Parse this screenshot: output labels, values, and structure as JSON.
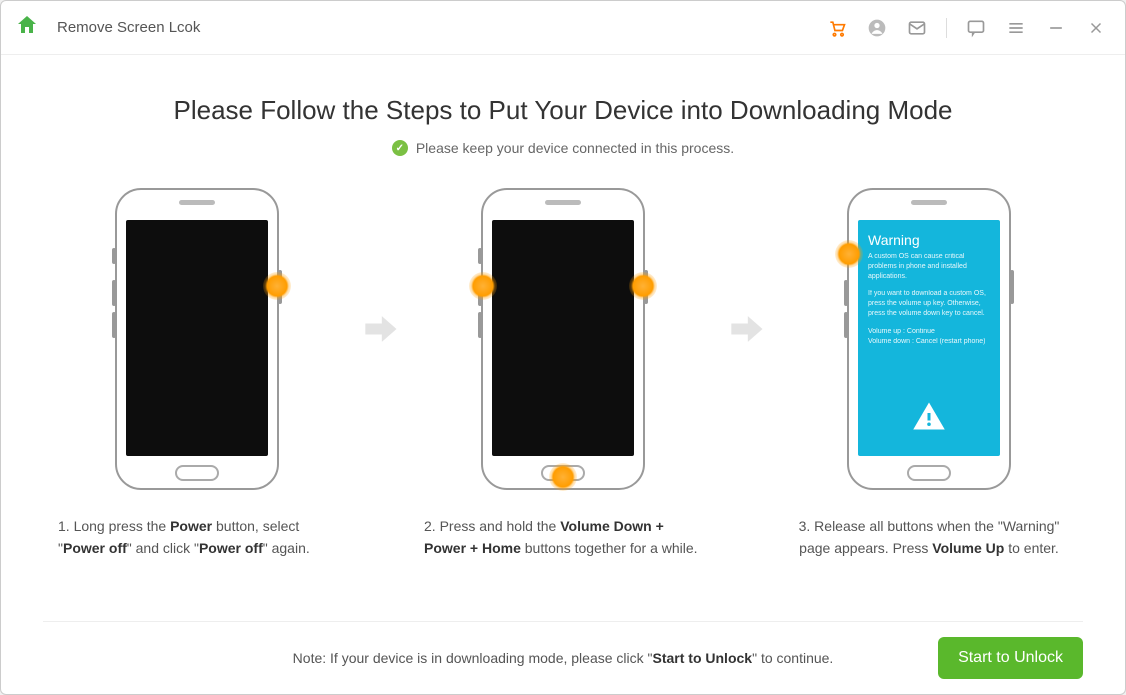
{
  "titlebar": {
    "title": "Remove Screen Lcok"
  },
  "main": {
    "heading": "Please Follow the Steps to Put Your Device into Downloading Mode",
    "subline": "Please keep your device connected in this process.",
    "steps": [
      {
        "num": "1.",
        "t1": " Long press the ",
        "b1": "Power",
        "t2": " button, select \"",
        "b2": "Power off",
        "t3": "\" and click \"",
        "b3": "Power off",
        "t4": "\" again."
      },
      {
        "num": "2.",
        "t1": " Press and hold the ",
        "b1": "Volume Down + Power + Home",
        "t2": " buttons together for a while."
      },
      {
        "num": "3.",
        "t1": " Release all buttons when the \"Warning\" page appears. Press ",
        "b1": "Volume Up",
        "t2": " to enter."
      }
    ],
    "warning_screen": {
      "title": "Warning",
      "p1": "A custom OS can cause critical problems in phone and installed applications.",
      "p2": "If you want to download a custom OS, press the volume up key. Otherwise, press the volume down key to cancel.",
      "volup": "Volume up : Continue",
      "voldown": "Volume down : Cancel (restart phone)"
    }
  },
  "footer": {
    "note_prefix": "Note: If your device is in downloading mode, please click \"",
    "note_bold": "Start to Unlock",
    "note_suffix": "\" to continue.",
    "button": "Start to Unlock"
  }
}
